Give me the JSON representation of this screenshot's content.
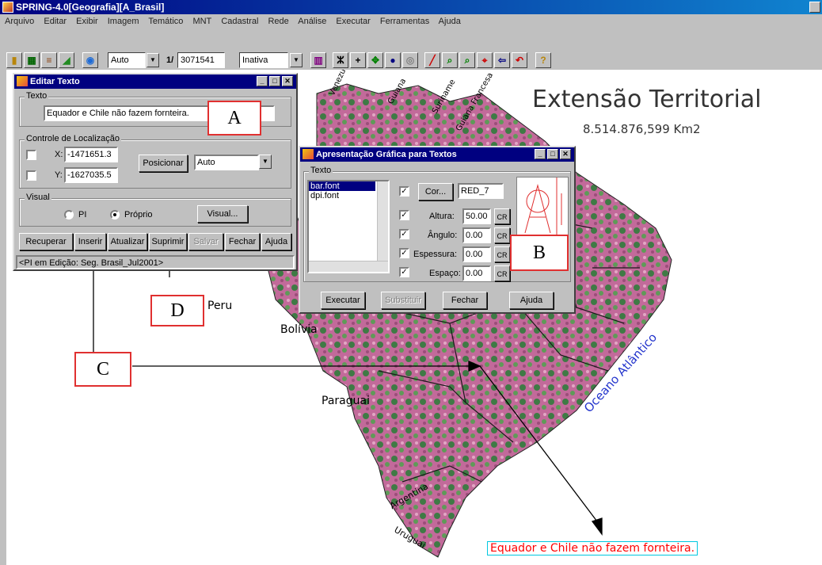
{
  "window": {
    "title": "SPRING-4.0[Geografia][A_Brasil]"
  },
  "menu": [
    "Arquivo",
    "Editar",
    "Exibir",
    "Imagem",
    "Temático",
    "MNT",
    "Cadastral",
    "Rede",
    "Análise",
    "Executar",
    "Ferramentas",
    "Ajuda"
  ],
  "toolbar": {
    "zoom_mode": "Auto",
    "scale_prefix": "1/",
    "scale_value": "3071541",
    "status_select": "Inativa",
    "help_icon": "?"
  },
  "map": {
    "title": "Extensão Territorial",
    "area": "8.514.876,599 Km2",
    "ocean": "Oceano Atlântico",
    "countries": [
      "Venezuela",
      "Guiana",
      "Suriname",
      "Guiana Francesa",
      "Peru",
      "Bolívia",
      "Paraguai",
      "Argentina",
      "Uruguai"
    ],
    "inserted_text": "Equador e Chile não fazem fornteira.",
    "text_color": "#ff0000",
    "box_color": "#00c8e0"
  },
  "editar_texto": {
    "title": "Editar Texto",
    "text_group": "Texto",
    "text_value": "Equador e Chile não fazem fornteira.",
    "loc_group": "Controle de Localização",
    "x_label": "X:",
    "x_value": "-1471651.3",
    "y_label": "Y:",
    "y_value": "-1627035.5",
    "position_button": "Posicionar",
    "position_mode": "Auto",
    "visual_group": "Visual",
    "radio_pi": "PI",
    "radio_proprio": "Próprio",
    "visual_button": "Visual...",
    "buttons": {
      "recuperar": "Recuperar",
      "inserir": "Inserir",
      "atualizar": "Atualizar",
      "suprimir": "Suprimir",
      "salvar": "Salvar",
      "fechar": "Fechar",
      "ajuda": "Ajuda"
    },
    "status": "<PI em Edição: Seg. Brasil_Jul2001>"
  },
  "apresentacao": {
    "title": "Apresentação Gráfica para Textos",
    "text_group": "Texto",
    "fonts": [
      "bar.font",
      "dpi.font"
    ],
    "cor_button": "Cor...",
    "color_name": "RED_7",
    "altura_label": "Altura:",
    "altura_value": "50.00",
    "angulo_label": "Ângulo:",
    "angulo_value": "0.00",
    "espessura_label": "Espessura:",
    "espessura_value": "0.00",
    "espaco_label": "Espaço:",
    "espaco_value": "0.00",
    "cr_label": "CR",
    "buttons": {
      "executar": "Executar",
      "substituir": "Substituir",
      "fechar": "Fechar",
      "ajuda": "Ajuda"
    }
  },
  "callouts": {
    "a": "A",
    "b": "B",
    "c": "C",
    "d": "D"
  }
}
